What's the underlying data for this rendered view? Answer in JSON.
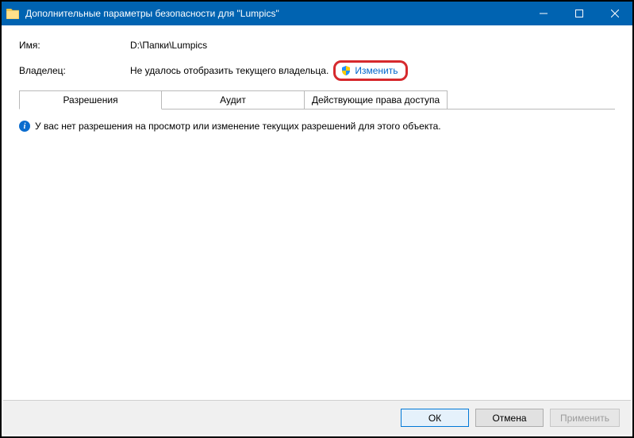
{
  "titlebar": {
    "title": "Дополнительные параметры безопасности  для \"Lumpics\""
  },
  "fields": {
    "name_label": "Имя:",
    "name_value": "D:\\Папки\\Lumpics",
    "owner_label": "Владелец:",
    "owner_value": "Не удалось отобразить текущего владельца.",
    "change_link": "Изменить"
  },
  "tabs": {
    "permissions": "Разрешения",
    "audit": "Аудит",
    "effective": "Действующие права доступа"
  },
  "body": {
    "no_permission_msg": "У вас нет разрешения на просмотр или изменение текущих разрешений для этого объекта."
  },
  "buttons": {
    "ok": "ОК",
    "cancel": "Отмена",
    "apply": "Применить"
  }
}
